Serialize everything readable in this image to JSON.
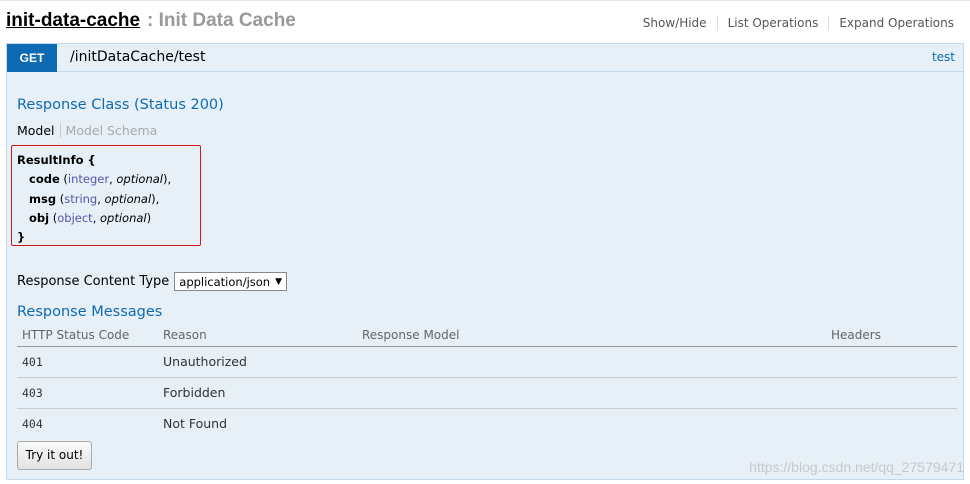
{
  "resource": {
    "name": "init-data-cache",
    "description": ": Init Data Cache"
  },
  "header_links": [
    "Show/Hide",
    "List Operations",
    "Expand Operations"
  ],
  "operation": {
    "method": "GET",
    "path": "/initDataCache/test",
    "summary": "test"
  },
  "response_class": {
    "title": "Response Class (Status 200)",
    "tabs": [
      "Model",
      "Model Schema"
    ],
    "model": {
      "open": "ResultInfo {",
      "close": "}",
      "properties": [
        {
          "name": "code",
          "open": " (",
          "type": "integer",
          "sep": ", ",
          "optional": "optional",
          "end": "),"
        },
        {
          "name": "msg",
          "open": " (",
          "type": "string",
          "sep": ", ",
          "optional": "optional",
          "end": "),"
        },
        {
          "name": "obj",
          "open": " (",
          "type": "object",
          "sep": ", ",
          "optional": "optional",
          "end": ")"
        }
      ]
    }
  },
  "content_type": {
    "label": "Response Content Type",
    "selected": "application/json"
  },
  "response_messages": {
    "title": "Response Messages",
    "columns": [
      "HTTP Status Code",
      "Reason",
      "Response Model",
      "Headers"
    ],
    "rows": [
      {
        "code": "401",
        "reason": "Unauthorized"
      },
      {
        "code": "403",
        "reason": "Forbidden"
      },
      {
        "code": "404",
        "reason": "Not Found"
      }
    ]
  },
  "try_button": "Try it out!",
  "watermark": "https://blog.csdn.net/qq_27579471",
  "colors": {
    "get_method": "#0f6ab4",
    "panel_bg": "#e7f0f7",
    "panel_border": "#c3d9ec",
    "model_highlight": "#d01818"
  }
}
